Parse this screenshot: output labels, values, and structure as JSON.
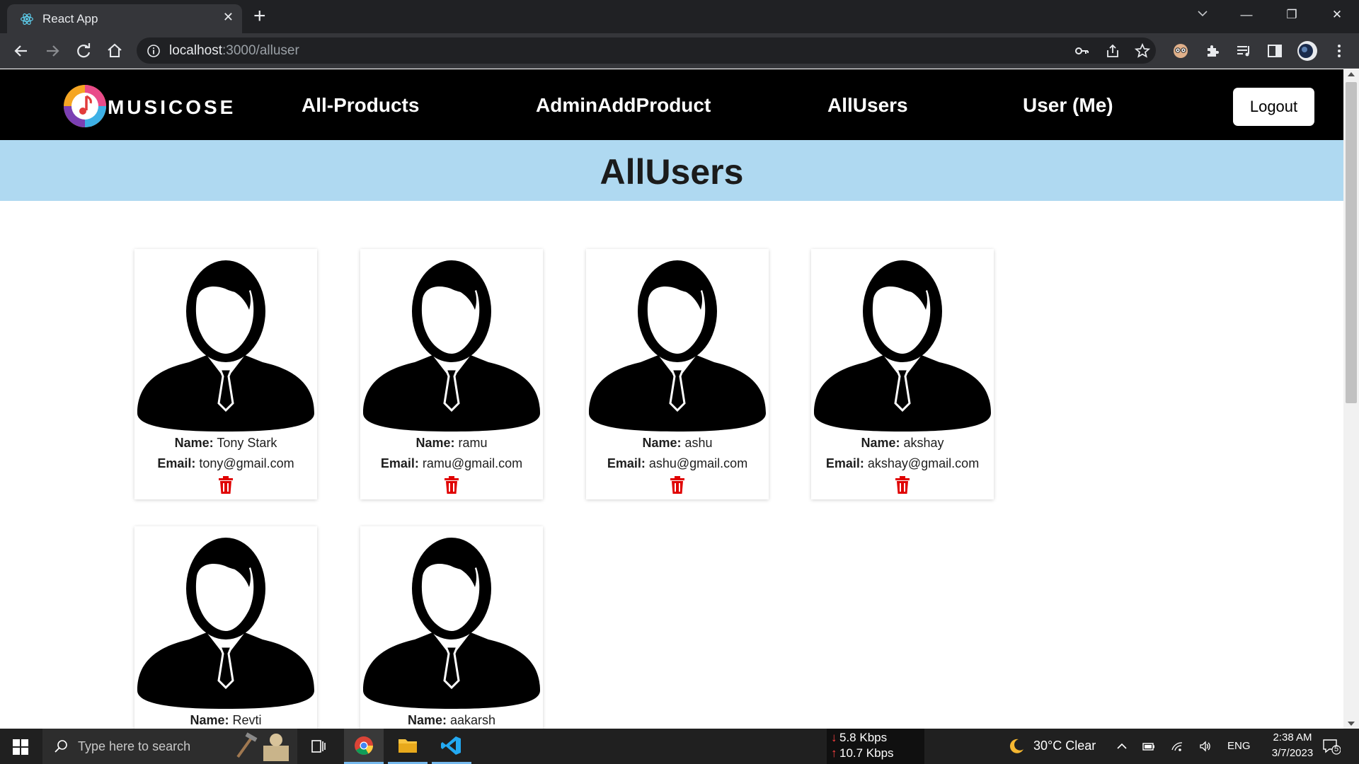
{
  "browser": {
    "tab_title": "React App",
    "tab_close": "✕",
    "new_tab": "+",
    "url_host": "localhost",
    "url_path": ":3000/alluser"
  },
  "window_controls": {
    "minimize": "—",
    "restore": "❐",
    "close": "✕"
  },
  "navbar": {
    "logo_text": "MUSICOSE",
    "links": [
      "All-Products",
      "AdminAddProduct",
      "AllUsers",
      "User (Me)"
    ],
    "logout_label": "Logout"
  },
  "page": {
    "title": "AllUsers"
  },
  "labels": {
    "name": "Name:",
    "email": "Email:"
  },
  "users": [
    {
      "name": "Tony Stark",
      "email": "tony@gmail.com"
    },
    {
      "name": "ramu",
      "email": "ramu@gmail.com"
    },
    {
      "name": "ashu",
      "email": "ashu@gmail.com"
    },
    {
      "name": "akshay",
      "email": "akshay@gmail.com"
    },
    {
      "name": "Revti",
      "email": ""
    },
    {
      "name": "aakarsh",
      "email": ""
    }
  ],
  "taskbar": {
    "search_placeholder": "Type here to search",
    "net_down": "5.8 Kbps",
    "net_up": "10.7 Kbps",
    "weather": "30°C  Clear",
    "language": "ENG",
    "time": "2:38 AM",
    "date": "3/7/2023",
    "notification_count": "5"
  },
  "colors": {
    "navbar_bg": "#000000",
    "title_band_bg": "#afd9f1",
    "trash_icon": "#e00000",
    "page_title": "#1b1b1b"
  }
}
